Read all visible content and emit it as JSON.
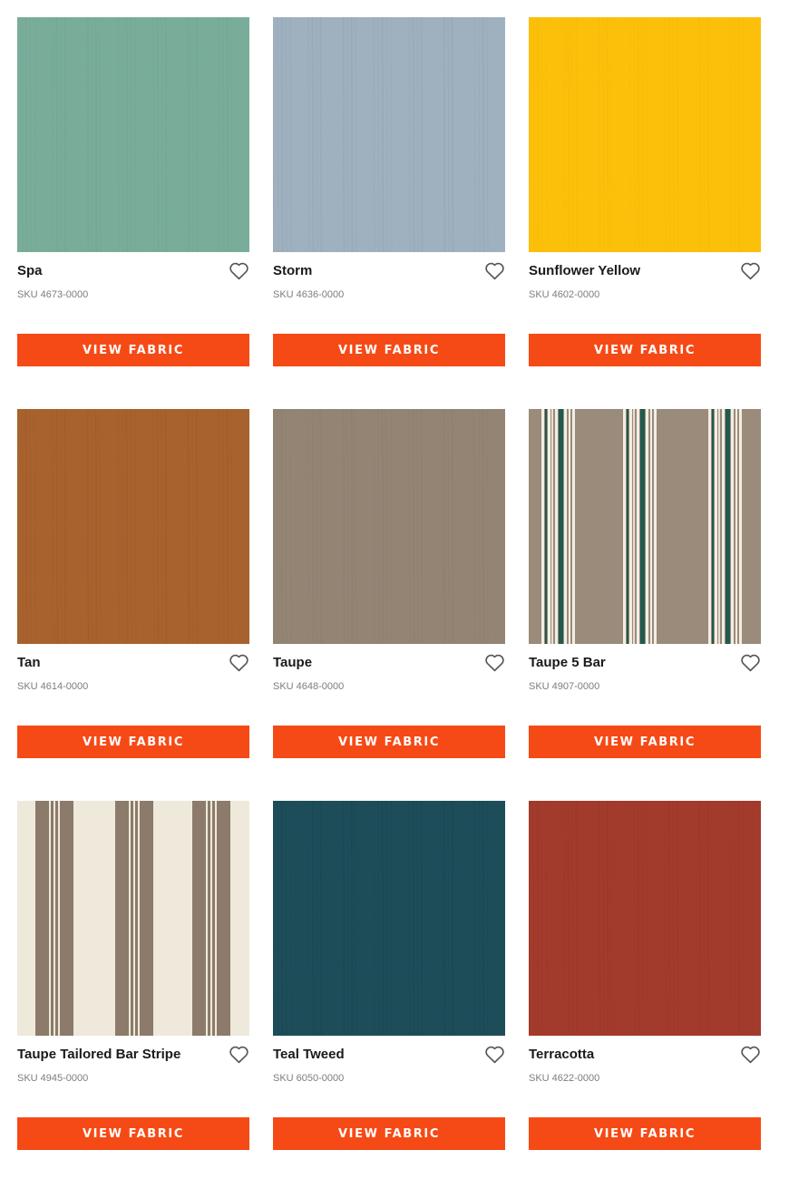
{
  "products": [
    {
      "name": "Spa",
      "sku": "SKU 4673-0000",
      "swatch": {
        "pattern": "solid",
        "color": "#79ad9a",
        "texture": "#6c9f8c"
      }
    },
    {
      "name": "Storm",
      "sku": "SKU 4636-0000",
      "swatch": {
        "pattern": "solid",
        "color": "#9fb0bf",
        "texture": "#8a9cac"
      }
    },
    {
      "name": "Sunflower Yellow",
      "sku": "SKU 4602-0000",
      "swatch": {
        "pattern": "solid",
        "color": "#fcbf0a",
        "texture": "#f2b505"
      }
    },
    {
      "name": "Tan",
      "sku": "SKU 4614-0000",
      "swatch": {
        "pattern": "solid",
        "color": "#a8622d",
        "texture": "#96562a"
      }
    },
    {
      "name": "Taupe",
      "sku": "SKU 4648-0000",
      "swatch": {
        "pattern": "solid",
        "color": "#938474",
        "texture": "#887a6b"
      }
    },
    {
      "name": "Taupe 5 Bar",
      "sku": "SKU 4907-0000",
      "swatch": {
        "pattern": "stripe-5bar",
        "color": "#9a8b7a",
        "accent": "#1e5a4d",
        "light": "#f2ede4"
      }
    },
    {
      "name": "Taupe Tailored Bar Stripe",
      "sku": "SKU 4945-0000",
      "swatch": {
        "pattern": "stripe-tailored",
        "color": "#efe9dc",
        "accent": "#8c7b6a"
      }
    },
    {
      "name": "Teal Tweed",
      "sku": "SKU 6050-0000",
      "swatch": {
        "pattern": "solid",
        "color": "#1e4d5a",
        "texture": "#153f4b"
      }
    },
    {
      "name": "Terracotta",
      "sku": "SKU 4622-0000",
      "swatch": {
        "pattern": "solid",
        "color": "#a23b2c",
        "texture": "#953426"
      }
    }
  ],
  "button_label": "VIEW FABRIC",
  "icons": {
    "favorite": "heart-outline-icon"
  },
  "colors": {
    "accent": "#f64a16",
    "title": "#1a1a1a",
    "sku": "#7d7d7d",
    "heart": "#555555"
  }
}
